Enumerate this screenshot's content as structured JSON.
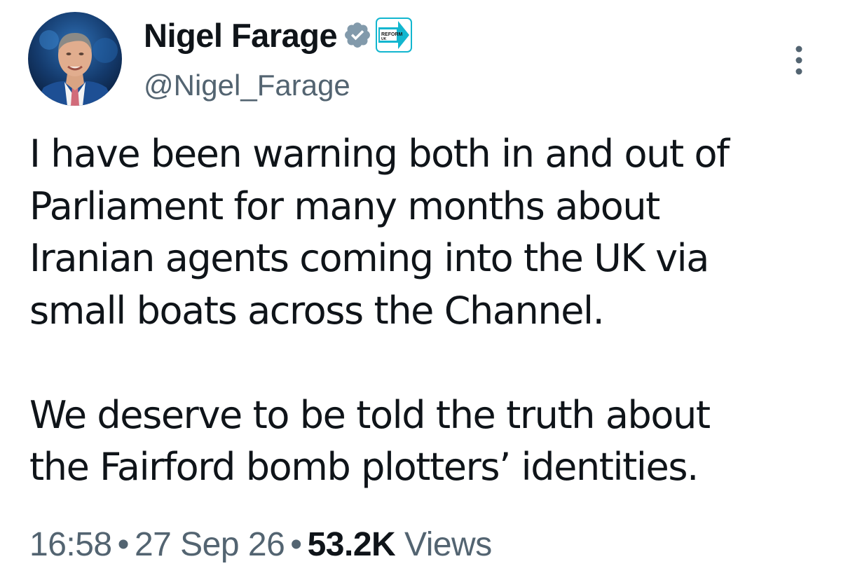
{
  "author": {
    "display_name": "Nigel Farage",
    "handle": "@Nigel_Farage",
    "avatar_icon": "profile-photo",
    "verified_icon": "verified-badge-icon",
    "verified_color": "#829aab",
    "affiliate_badge": {
      "icon": "reform-uk-logo-icon",
      "line1": "REFORM",
      "line2": "UK",
      "color": "#12b6cf"
    }
  },
  "menu": {
    "icon": "more-options-icon"
  },
  "tweet": {
    "lines_p1": [
      "I have been warning both in and out of",
      "Parliament for many months about",
      "Iranian agents coming into the UK via",
      "small boats across the Channel."
    ],
    "lines_p2": [
      "We deserve to be told the truth about",
      "the Fairford bomb plotters’ identities."
    ]
  },
  "meta": {
    "time": "16:58",
    "separator": "•",
    "date": "27 Sep 26",
    "views_count": "53.2K",
    "views_label": "Views"
  },
  "colors": {
    "text_primary": "#0f1419",
    "text_secondary": "#536471"
  }
}
